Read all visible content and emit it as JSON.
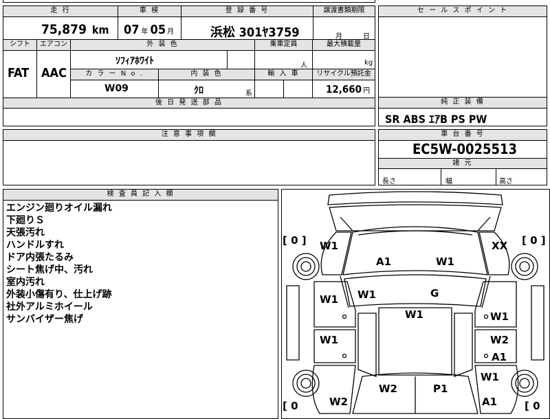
{
  "top_row": {
    "mileage": {
      "label": "走 行",
      "value": "75,879",
      "unit": "km"
    },
    "inspection": {
      "label": "車 検",
      "year": "07",
      "year_unit": "年",
      "month": "05",
      "month_unit": "月"
    },
    "registration": {
      "label": "登 録 番 号",
      "value": "浜松 301ﾔ3759"
    },
    "transfer_deadline": {
      "label": "譲渡書類期限",
      "month_unit": "月",
      "day_unit": "日"
    },
    "sales_point": {
      "label": "セ ー ル ス ポ イ ン ト"
    }
  },
  "spec_row": {
    "shift": {
      "label": "シフト",
      "value": "FAT"
    },
    "aircon": {
      "label": "エアコン",
      "value": "AAC"
    },
    "exterior_color": {
      "label": "外 装 色",
      "value": "ｿﾌｨｱﾎﾜｲﾄ"
    },
    "capacity": {
      "label": "乗車定員",
      "unit": "人"
    },
    "max_load": {
      "label": "最大積載量",
      "unit": "kg"
    },
    "color_no": {
      "label": "カ ラ ー N o .",
      "value": "W09"
    },
    "interior_color": {
      "label": "内 装 色",
      "value": "ｸﾛ",
      "suffix": "系"
    },
    "import": {
      "label": "輸 入 車"
    },
    "recycle_fee": {
      "label": "リサイクル預託金",
      "value": "12,660",
      "unit": "円"
    }
  },
  "later_parts": {
    "label": "後 日 発 送 部 品"
  },
  "equipment": {
    "label": "純 正 装 備",
    "value": "SR ABS ｴｱB PS PW"
  },
  "cautions": {
    "label": "注 意 事 項 欄"
  },
  "chassis": {
    "label": "車 台 番 号",
    "value": "EC5W-0025513"
  },
  "dimensions": {
    "label": "諸 元",
    "length": "長さ",
    "width": "幅",
    "height": "高さ"
  },
  "inspector_notes": {
    "label": "検 査 員 記 入 欄",
    "lines": [
      "エンジン廻りオイル漏れ",
      "下廻りＳ",
      "天張汚れ",
      "ハンドルすれ",
      "ドア内張たるみ",
      "シート焦げ中、汚れ",
      "室内汚れ",
      "外装小傷有り、仕上げ跡",
      "社外アルミホイール",
      "サンバイザー焦げ"
    ]
  },
  "damage_map": {
    "marks": {
      "w1_fl_fender": "W1",
      "xx_fr_fender": "XX",
      "a1_hood_left": "A1",
      "w1_hood_right": "W1",
      "w1_pillar_left": "W1",
      "g_windshield": "G",
      "w1_roof": "W1",
      "w1_door_fl": "W1",
      "w1_door_fr": "W1",
      "w1_door_rl": "W1",
      "w2_door_rr": "W2",
      "a1_door_rr": "A1",
      "w1_quarter_r": "W1",
      "w2_rear_left": "W2",
      "p1_rear_right": "P1",
      "w2_quarter_l": "W2",
      "a1_quarter_r": "A1"
    },
    "tire_left_front": "[ 0 ]",
    "tire_right_front": "[ 0 ]",
    "tire_left_rear": "[ 0",
    "tire_right_rear": "[ 0"
  }
}
